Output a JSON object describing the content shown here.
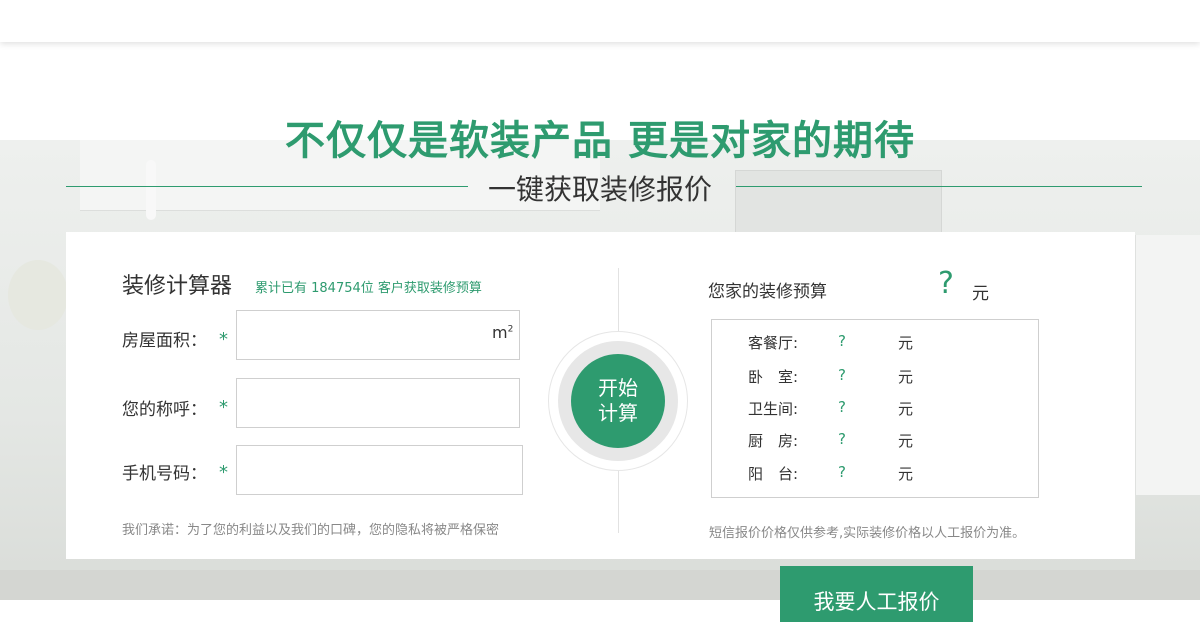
{
  "headline": "不仅仅是软装产品 更是对家的期待",
  "subtitle": "一键获取装修报价",
  "calculator": {
    "title": "装修计算器",
    "count_text": "累计已有 184754位 客户获取装修预算",
    "fields": [
      {
        "label": "房屋面积：",
        "required": "*",
        "value": "",
        "unit": "m",
        "unit_sup": "2"
      },
      {
        "label": "您的称呼：",
        "required": "*",
        "value": ""
      },
      {
        "label": "手机号码：",
        "required": "*",
        "value": ""
      }
    ],
    "promise": "我们承诺：为了您的利益以及我们的口碑，您的隐私将被严格保密",
    "start_button": "开始计算"
  },
  "budget": {
    "label": "您家的装修预算",
    "total": "?",
    "unit": "元",
    "rows": [
      {
        "room": "客餐厅:",
        "value": "?",
        "unit": "元"
      },
      {
        "room": "卧　室:",
        "value": "?",
        "unit": "元"
      },
      {
        "room": "卫生间:",
        "value": "?",
        "unit": "元"
      },
      {
        "room": "厨　房:",
        "value": "?",
        "unit": "元"
      },
      {
        "room": "阳　台:",
        "value": "?",
        "unit": "元"
      }
    ],
    "disclaimer": "短信报价价格仅供参考,实际装修价格以人工报价为准。"
  },
  "manual_button": "我要人工报价",
  "colors": {
    "accent": "#2e9b6f",
    "text": "#333333",
    "muted": "#888888"
  }
}
